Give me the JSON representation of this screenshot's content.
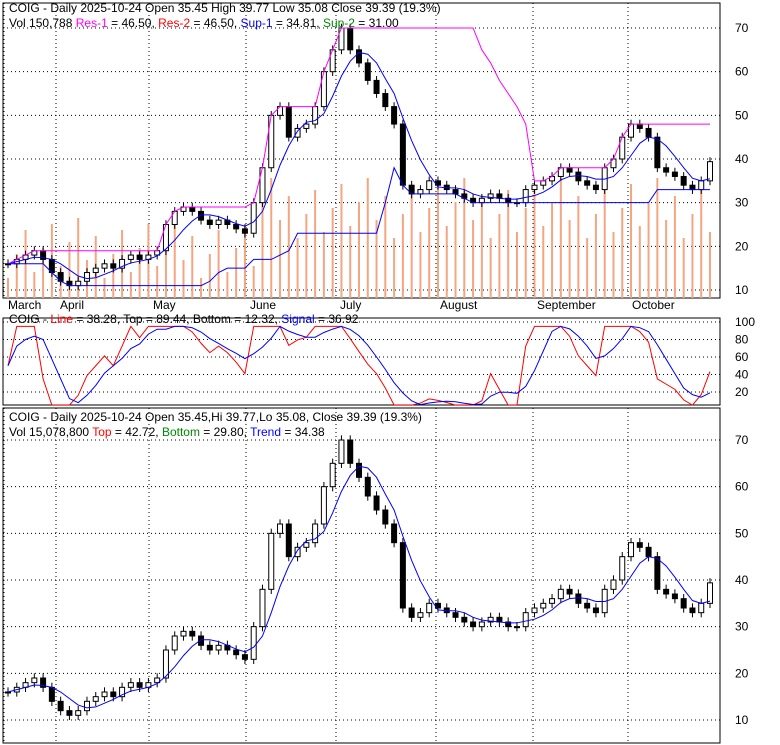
{
  "panel1": {
    "line1": "COIG - Daily 2025-10-24 Open 35.45  High 39.77  Low 35.08  Close 39.39 (19.3%)",
    "vol": "Vol 150,788",
    "res1_label": "Res-1",
    "res1": " = 46.50, ",
    "res2_label": "Res-2",
    "res2": " = 46.50, ",
    "sup1_label": "Sup-1",
    "sup1": " = 34.81, ",
    "sup2_label": "Sup-2",
    "sup2": " = 31.00"
  },
  "panel2": {
    "prefix": "COIG - ",
    "line_label": "Line",
    "line": " = 38.28, Top = 89.44, Bottom = 12.32, ",
    "signal_label": "Signal",
    "signal": " = 36.92"
  },
  "panel3": {
    "line1": "COIG - Daily 2025-10-24 Open 35.45,Hi 39.77,Lo 35.08, Close 39.39 (19.3%)",
    "vol": "Vol 15,078,800 ",
    "top_label": "Top",
    "top": " = 42.72, ",
    "bottom_label": "Bottom",
    "bottom": " = 29.80, ",
    "trend_label": "Trend",
    "trend": " = 34.38"
  },
  "chart_data": {
    "type": "candlestick",
    "months": [
      "March",
      "April",
      "May",
      "June",
      "July",
      "August",
      "September",
      "October"
    ],
    "price_ticks": [
      10,
      20,
      30,
      40,
      50,
      60,
      70
    ],
    "osc_ticks": [
      20,
      40,
      60,
      80,
      100
    ],
    "closes": [
      16,
      17,
      18,
      19,
      17,
      14,
      12,
      11,
      12,
      14,
      15,
      16,
      15,
      17,
      18,
      17,
      18,
      19,
      25,
      28,
      29,
      28,
      26,
      25,
      26,
      25,
      24,
      23,
      30,
      38,
      50,
      52,
      45,
      47,
      48,
      52,
      60,
      65,
      70,
      65,
      62,
      58,
      55,
      52,
      48,
      34,
      32,
      33,
      35,
      34,
      33,
      32,
      31,
      30,
      31,
      32,
      31,
      30,
      30,
      33,
      34,
      35,
      36,
      38,
      37,
      35,
      34,
      33,
      38,
      40,
      45,
      48,
      47,
      45,
      38,
      37,
      36,
      34,
      33,
      35,
      39.39
    ],
    "colors": {
      "res1": "#ff00ff",
      "res2": "#ff0000",
      "sup1": "#0000ff",
      "sup2": "#008000",
      "volume": "#f4a582"
    }
  }
}
